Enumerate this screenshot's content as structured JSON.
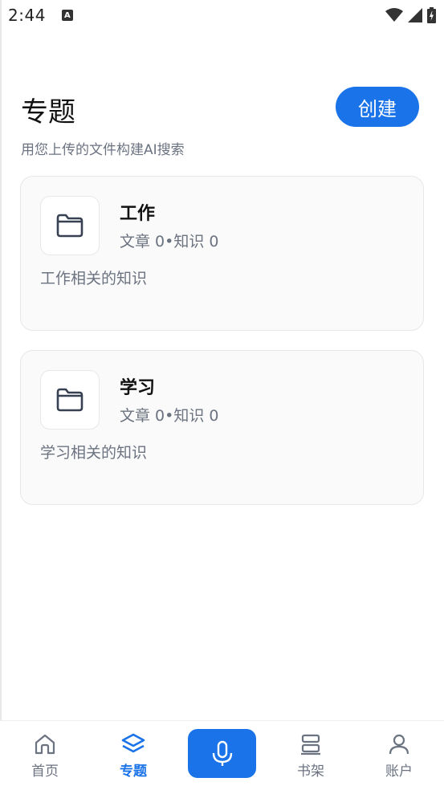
{
  "status_bar": {
    "time": "2:44",
    "notification_badge": "A"
  },
  "header": {
    "title": "专题",
    "create_label": "创建",
    "subtitle": "用您上传的文件构建AI搜索"
  },
  "topics": [
    {
      "title": "工作",
      "stats": "文章 0•知识 0",
      "description": "工作相关的知识"
    },
    {
      "title": "学习",
      "stats": "文章 0•知识 0",
      "description": "学习相关的知识"
    }
  ],
  "bottom_nav": {
    "items": [
      {
        "label": "首页",
        "icon": "home-icon",
        "active": false
      },
      {
        "label": "专题",
        "icon": "layers-icon",
        "active": true
      },
      {
        "label": "书架",
        "icon": "bookshelf-icon",
        "active": false
      },
      {
        "label": "账户",
        "icon": "user-icon",
        "active": false
      }
    ],
    "mic_icon": "microphone-icon"
  },
  "colors": {
    "accent": "#1a73e8",
    "muted_text": "#6b7280",
    "card_bg": "#fafafa"
  }
}
